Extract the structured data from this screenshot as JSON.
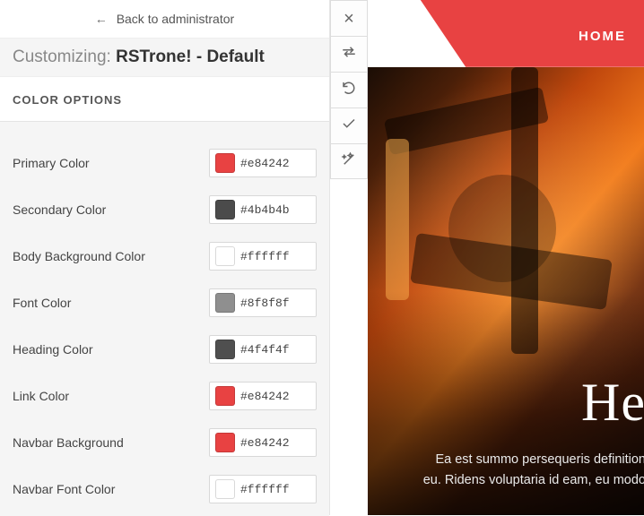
{
  "back_label": "Back to administrator",
  "customizing_prefix": "Customizing: ",
  "template_name": "RSTrone! - Default",
  "section_title": "COLOR OPTIONS",
  "options": [
    {
      "label": "Primary Color",
      "hex": "#e84242"
    },
    {
      "label": "Secondary Color",
      "hex": "#4b4b4b"
    },
    {
      "label": "Body Background Color",
      "hex": "#ffffff"
    },
    {
      "label": "Font Color",
      "hex": "#8f8f8f"
    },
    {
      "label": "Heading Color",
      "hex": "#4f4f4f"
    },
    {
      "label": "Link Color",
      "hex": "#e84242"
    },
    {
      "label": "Navbar Background",
      "hex": "#e84242"
    },
    {
      "label": "Navbar Font Color",
      "hex": "#ffffff"
    }
  ],
  "nav": {
    "home": "HOME"
  },
  "hero": {
    "title_visible_fragment": "He",
    "subtitle_line1": "Ea est summo persequeris definition",
    "subtitle_line2": "eu. Ridens voluptaria id eam, eu modo"
  },
  "accent": "#e84242"
}
